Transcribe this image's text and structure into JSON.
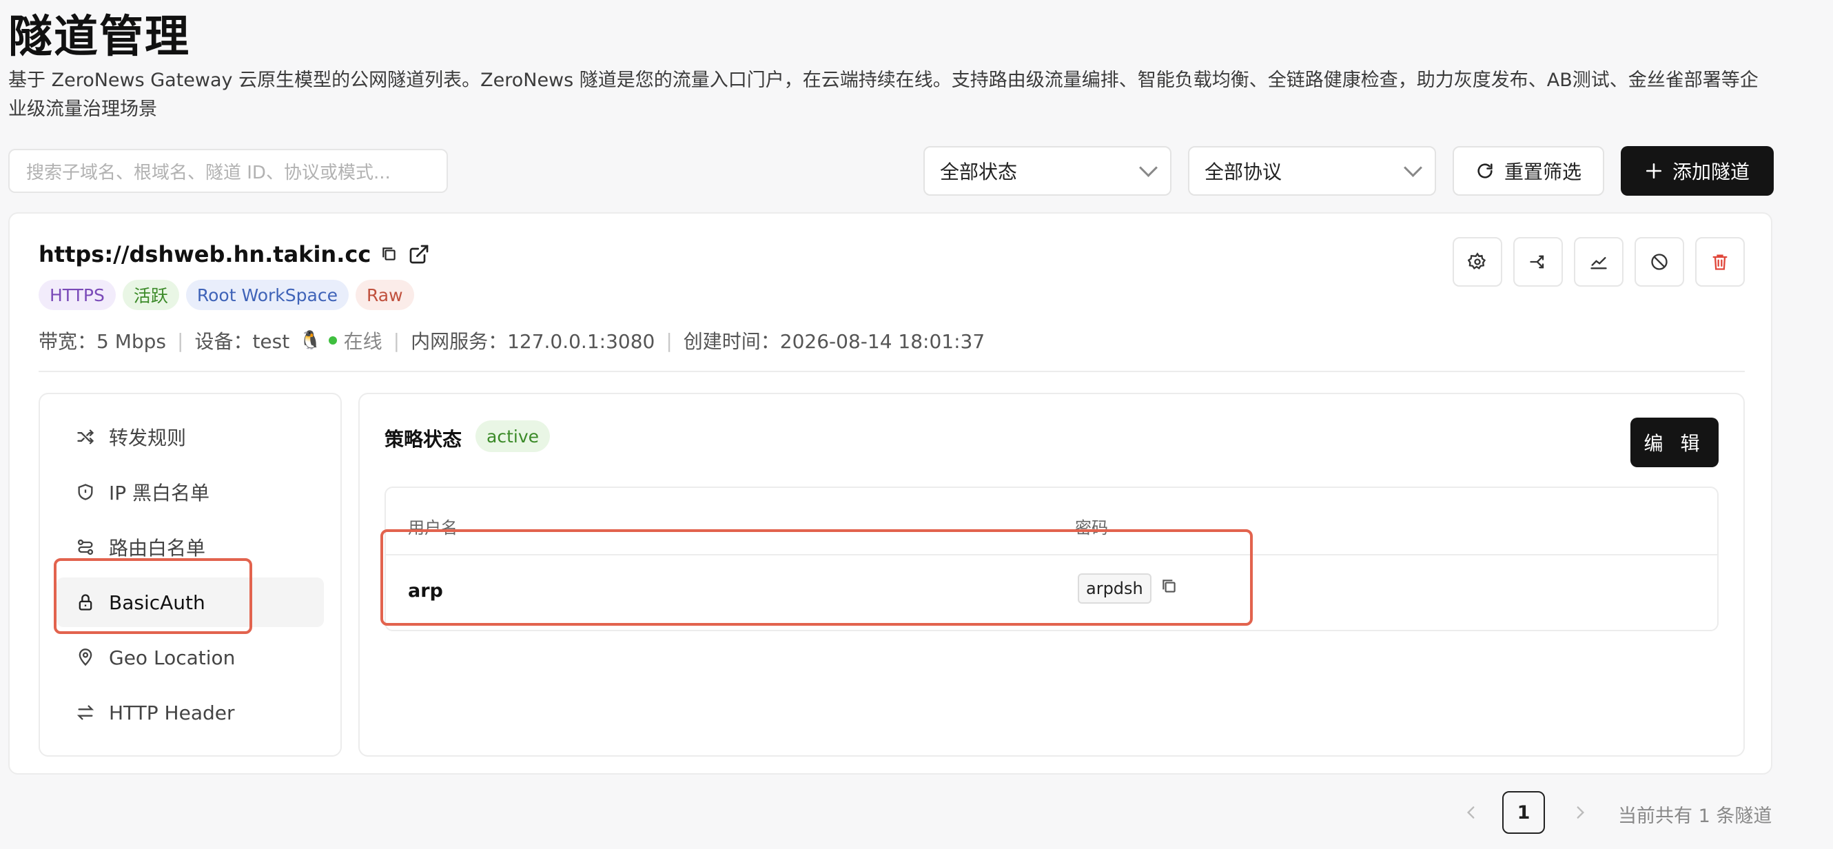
{
  "header": {
    "title": "隧道管理",
    "description": "基于 ZeroNews Gateway 云原生模型的公网隧道列表。ZeroNews 隧道是您的流量入口门户，在云端持续在线。支持路由级流量编排、智能负载均衡、全链路健康检查，助力灰度发布、AB测试、金丝雀部署等企业级流量治理场景"
  },
  "filters": {
    "search_placeholder": "搜索子域名、根域名、隧道 ID、协议或模式...",
    "status_value": "全部状态",
    "protocol_value": "全部协议",
    "reset_label": "重置筛选",
    "add_label": "添加隧道"
  },
  "tunnel": {
    "url": "https://dshweb.hn.takin.cc",
    "tags": [
      "HTTPS",
      "活跃",
      "Root WorkSpace",
      "Raw"
    ],
    "bandwidth": "带宽：5 Mbps",
    "device": "设备：test",
    "online": "在线",
    "service": "内网服务：127.0.0.1:3080",
    "created": "创建时间：2026-08-14 18:01:37"
  },
  "sidebar": {
    "items": [
      {
        "label": "转发规则",
        "icon": "shuffle-icon"
      },
      {
        "label": "IP 黑白名单",
        "icon": "shield-icon"
      },
      {
        "label": "路由白名单",
        "icon": "route-icon"
      },
      {
        "label": "BasicAuth",
        "icon": "lock-icon"
      },
      {
        "label": "Geo Location",
        "icon": "location-pin-icon"
      },
      {
        "label": "HTTP Header",
        "icon": "swap-arrows-icon"
      }
    ],
    "selected": "BasicAuth"
  },
  "policy": {
    "title": "策略状态",
    "status": "active",
    "edit_label": "编 辑",
    "columns": [
      "用户名",
      "密码"
    ],
    "rows": [
      {
        "username": "arp",
        "password": "arpdsh"
      }
    ]
  },
  "pagination": {
    "current_page": "1",
    "total_text": "当前共有 1 条隧道"
  },
  "colors": {
    "accent_dark": "#141414",
    "highlight": "#e2634e",
    "online": "#3fbf3f"
  }
}
